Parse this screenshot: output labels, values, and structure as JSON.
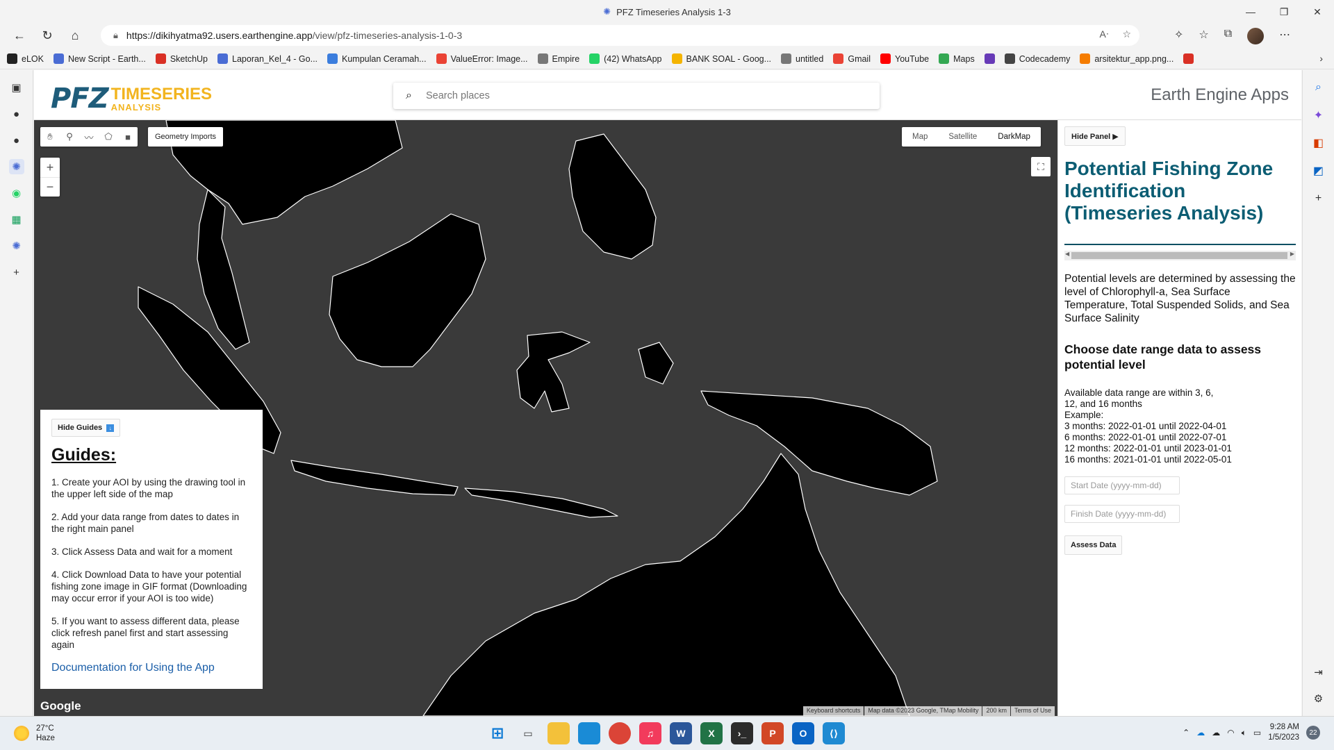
{
  "browser": {
    "window_title": "PFZ Timeseries Analysis 1-3",
    "url_host": "https://dikihyatma92.users.earthengine.app",
    "url_path": "/view/pfz-timeseries-analysis-1-0-3",
    "bookmarks": [
      {
        "label": "eLOK",
        "icon": "elok-icon",
        "color": "#222222"
      },
      {
        "label": "New Script - Earth...",
        "icon": "earth-engine-icon",
        "color": "#4a6cd4"
      },
      {
        "label": "SketchUp",
        "icon": "sketchup-icon",
        "color": "#d93025"
      },
      {
        "label": "Laporan_Kel_4 - Go...",
        "icon": "docs-icon",
        "color": "#4a6cd4"
      },
      {
        "label": "Kumpulan Ceramah...",
        "icon": "link-icon",
        "color": "#3b7ddd"
      },
      {
        "label": "ValueError: Image...",
        "icon": "google-icon",
        "color": "#ea4335"
      },
      {
        "label": "Empire",
        "icon": "page-icon",
        "color": "#777777"
      },
      {
        "label": "(42) WhatsApp",
        "icon": "whatsapp-icon",
        "color": "#25d366"
      },
      {
        "label": "BANK SOAL - Goog...",
        "icon": "drive-icon",
        "color": "#f4b400"
      },
      {
        "label": "untitled",
        "icon": "page-icon",
        "color": "#777777"
      },
      {
        "label": "Gmail",
        "icon": "gmail-icon",
        "color": "#ea4335"
      },
      {
        "label": "YouTube",
        "icon": "youtube-icon",
        "color": "#ff0000"
      },
      {
        "label": "Maps",
        "icon": "maps-icon",
        "color": "#34a853"
      },
      {
        "label": "",
        "icon": "forms-icon",
        "color": "#673ab7"
      },
      {
        "label": "Codecademy",
        "icon": "codecademy-icon",
        "color": "#444444"
      },
      {
        "label": "arsitektur_app.png...",
        "icon": "image-icon",
        "color": "#f57c00"
      },
      {
        "label": "",
        "icon": "pdf-icon",
        "color": "#d93025"
      }
    ]
  },
  "app": {
    "logo_main": "PFZ",
    "logo_line1": "TIMESERIES",
    "logo_line2": "ANALYSIS",
    "search_placeholder": "Search places",
    "brand": "Earth Engine Apps"
  },
  "map": {
    "geometry_imports": "Geometry Imports",
    "zoom_in": "+",
    "zoom_out": "−",
    "map_types": [
      "Map",
      "Satellite",
      "DarkMap"
    ],
    "active_map_type": "DarkMap",
    "google": "Google",
    "attribution": [
      "Keyboard shortcuts",
      "Map data ©2023 Google, TMap Mobility",
      "200 km",
      "Terms of Use"
    ],
    "colors": {
      "water": "#3a3a3a",
      "land": "#000000",
      "roads": "#ffffff"
    }
  },
  "guides": {
    "hide_label": "Hide Guides",
    "title": "Guides:",
    "steps": [
      "1. Create your AOI by using the drawing tool in the upper left side of the map",
      "2. Add your data range from dates to dates in the right main panel",
      "3. Click Assess Data and wait for a moment",
      "4. Click Download Data to have your potential fishing zone image in GIF format (Downloading may occur error if your AOI is too wide)",
      "5. If you want to assess different data, please click refresh panel first and start assessing again"
    ],
    "doc_link": "Documentation for Using the App"
  },
  "panel": {
    "hide_label": "Hide Panel ▶",
    "title": "Potential Fishing Zone Identification (Timeseries Analysis)",
    "description": "Potential levels are determined by assessing the level of Chlorophyll-a, Sea Surface Temperature, Total Suspended Solids, and Sea Surface Salinity",
    "choose_heading": "Choose date range data to assess potential level",
    "avail_lines": [
      "Available data range are within 3, 6,",
      "12, and 16 months",
      "Example:",
      "3 months: 2022-01-01 until 2022-04-01",
      "6 months: 2022-01-01 until 2022-07-01",
      "12 months: 2022-01-01 until 2023-01-01",
      "16 months: 2021-01-01 until 2022-05-01"
    ],
    "start_placeholder": "Start Date (yyyy-mm-dd)",
    "finish_placeholder": "Finish Date (yyyy-mm-dd)",
    "assess_label": "Assess Data",
    "title_color": "#0c5d73"
  },
  "taskbar": {
    "temperature": "27°C",
    "weather": "Haze",
    "time": "9:28 AM",
    "date": "1/5/2023",
    "notifications": "22"
  }
}
